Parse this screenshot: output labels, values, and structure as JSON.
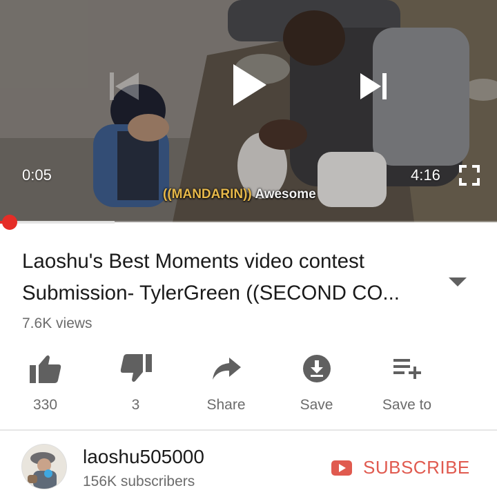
{
  "player": {
    "current_time": "0:05",
    "duration": "4:16",
    "progress_fraction": 0.02,
    "buffered_fraction": 0.23,
    "subtitle_tag": "((MANDARIN))",
    "subtitle_text": "Awesome"
  },
  "video": {
    "title": "Laoshu's Best Moments video contest Submission- TylerGreen ((SECOND CO...",
    "views": "7.6K views"
  },
  "actions": [
    {
      "name": "like",
      "label": "330",
      "icon": "thumbs-up-icon"
    },
    {
      "name": "dislike",
      "label": "3",
      "icon": "thumbs-down-icon"
    },
    {
      "name": "share",
      "label": "Share",
      "icon": "share-arrow-icon"
    },
    {
      "name": "save",
      "label": "Save",
      "icon": "download-icon"
    },
    {
      "name": "save-to",
      "label": "Save to",
      "icon": "playlist-add-icon"
    }
  ],
  "channel": {
    "name": "laoshu505000",
    "subscribers": "156K subscribers",
    "subscribe_label": "SUBSCRIBE"
  },
  "colors": {
    "accent": "#e52d27",
    "subscribe_text": "#e05a4f",
    "icon_gray": "#606060",
    "secondary_text": "#6b6b6b"
  }
}
